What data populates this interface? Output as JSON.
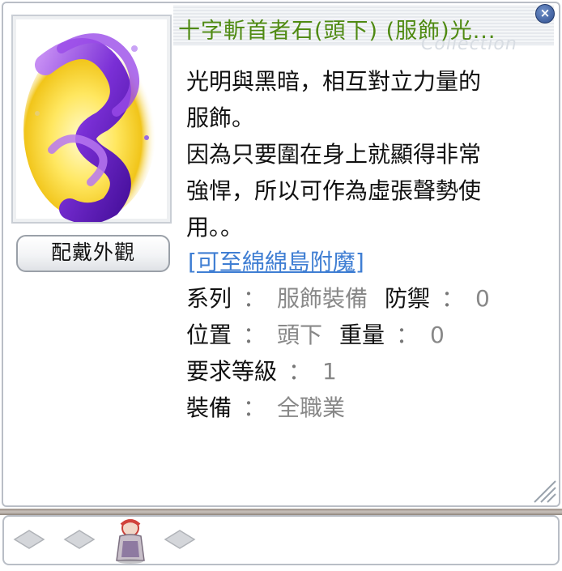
{
  "window": {
    "title": "十字斬首者石(頭下) (服飾)光...",
    "watermark": "Collection",
    "close_glyph": "×"
  },
  "illustration": {
    "icon": "purple-yellow-flame-costume-icon"
  },
  "appearance_button_label": "配戴外觀",
  "description": {
    "lines": [
      "光明與黑暗，相互對立力量的",
      "服飾。",
      "因為只要圍在身上就顯得非常",
      "強悍，所以可作為虛張聲勢使",
      "用。。"
    ]
  },
  "enchant_link": "[可至綿綿島附魔]",
  "stats": {
    "series_label": "系列",
    "series_value": "服飾裝備",
    "defense_label": "防禦",
    "defense_value": "0",
    "location_label": "位置",
    "location_value": "頭下",
    "weight_label": "重量",
    "weight_value": "0",
    "req_level_label": "要求等級",
    "req_level_value": "1",
    "equip_label": "裝備",
    "equip_value": "全職業",
    "colon": "："
  },
  "bottom_bar": {
    "slots": [
      "empty-card-slot-icon",
      "empty-card-slot-icon",
      "character-preview-icon",
      "empty-card-slot-icon"
    ]
  },
  "colors": {
    "title": "#4f8a12",
    "link": "#3f7ed3",
    "value": "#888888",
    "border": "#b9bec6"
  }
}
